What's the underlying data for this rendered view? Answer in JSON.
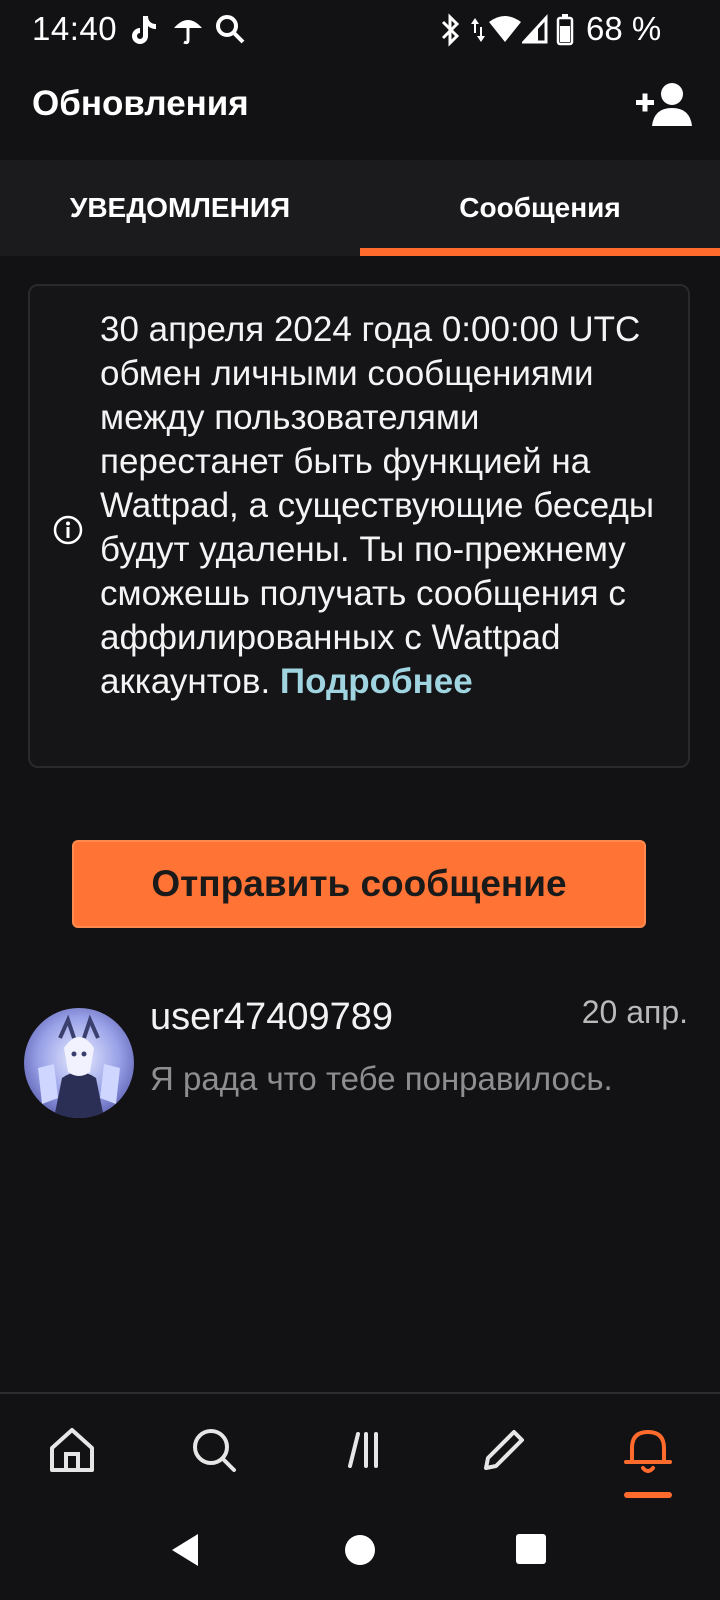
{
  "status_bar": {
    "time": "14:40",
    "battery": "68 %",
    "icons": [
      "tiktok-icon",
      "umbrella-icon",
      "search-icon",
      "bluetooth-icon",
      "data-arrows-icon",
      "wifi-icon",
      "signal-icon",
      "battery-icon"
    ]
  },
  "header": {
    "title": "Обновления",
    "add_friend_icon": "add-person-icon"
  },
  "tabs": [
    {
      "label": "УВЕДОМЛЕНИЯ",
      "active": false
    },
    {
      "label": "Сообщения",
      "active": true
    }
  ],
  "notice": {
    "icon": "info-icon",
    "text": "30 апреля 2024 года 0:00:00 UTC обмен личными сообщениями между пользователями перестанет быть функцией на Wattpad, а существующие беседы будут удалены. Ты по-прежнему сможешь получать сообщения с аффилированных с Wattpad аккаунтов.",
    "link": "Подробнее"
  },
  "send_button": {
    "label": "Отправить сообщение"
  },
  "conversations": [
    {
      "username": "user47409789",
      "date": "20 апр.",
      "preview": "Я рада что тебе понравилось."
    }
  ],
  "bottom_nav": [
    {
      "icon": "home-icon",
      "active": false
    },
    {
      "icon": "search-icon",
      "active": false
    },
    {
      "icon": "library-icon",
      "active": false
    },
    {
      "icon": "pencil-icon",
      "active": false
    },
    {
      "icon": "bell-icon",
      "active": true
    }
  ],
  "colors": {
    "background": "#121113",
    "accent": "#ff6b2d",
    "button": "#ff7334",
    "link": "#9fd4e0"
  }
}
